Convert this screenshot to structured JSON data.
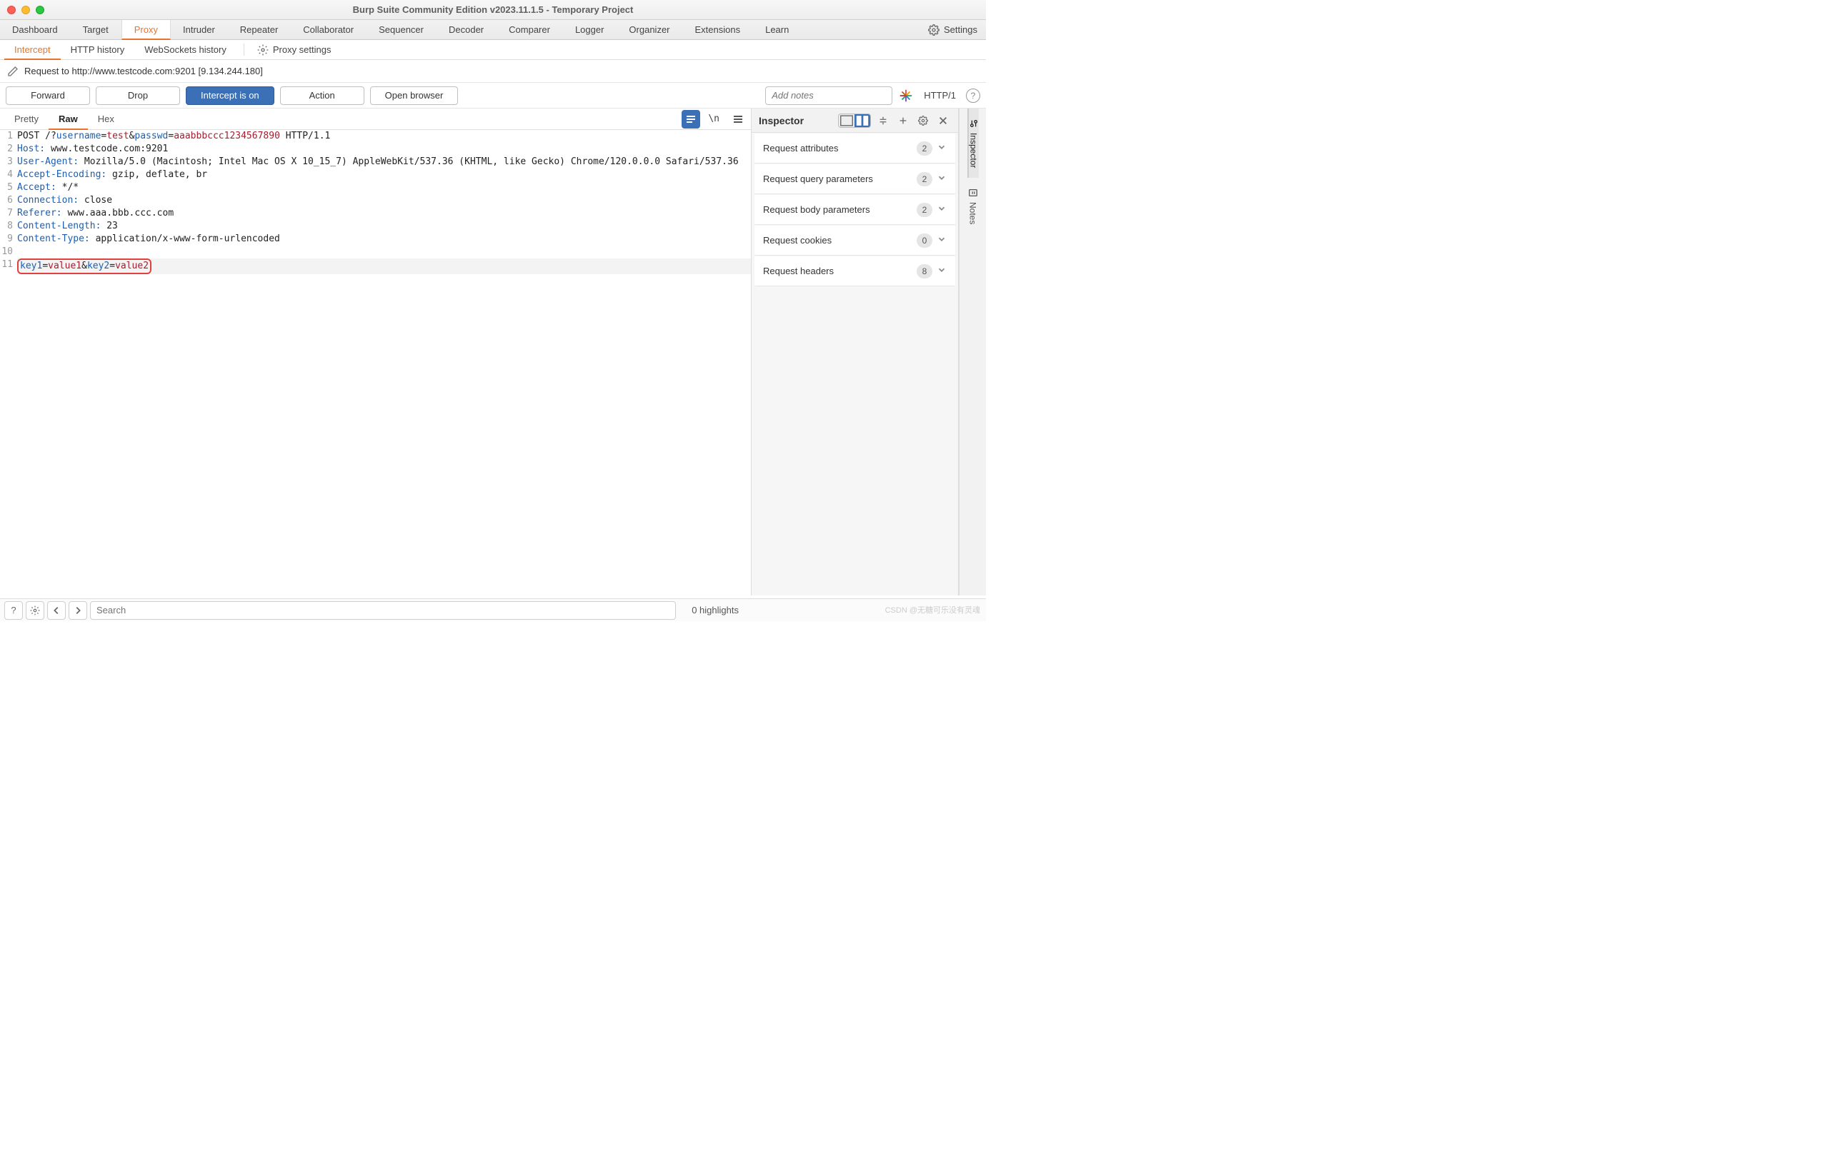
{
  "title": "Burp Suite Community Edition v2023.11.1.5 - Temporary Project",
  "mainTabs": [
    "Dashboard",
    "Target",
    "Proxy",
    "Intruder",
    "Repeater",
    "Collaborator",
    "Sequencer",
    "Decoder",
    "Comparer",
    "Logger",
    "Organizer",
    "Extensions",
    "Learn"
  ],
  "mainActive": "Proxy",
  "settingsLabel": "Settings",
  "subTabs": [
    "Intercept",
    "HTTP history",
    "WebSockets history"
  ],
  "subActive": "Intercept",
  "proxySettingsLabel": "Proxy settings",
  "requestLine": "Request to http://www.testcode.com:9201  [9.134.244.180]",
  "buttons": {
    "forward": "Forward",
    "drop": "Drop",
    "intercept": "Intercept is on",
    "action": "Action",
    "open": "Open browser"
  },
  "notesPlaceholder": "Add notes",
  "httpVersion": "HTTP/1",
  "viewTabs": [
    "Pretty",
    "Raw",
    "Hex"
  ],
  "viewActive": "Raw",
  "newlineLabel": "\\n",
  "rawLines": [
    {
      "n": 1,
      "segs": [
        {
          "t": "POST /?",
          "c": "plain"
        },
        {
          "t": "username",
          "c": "key"
        },
        {
          "t": "=",
          "c": "plain"
        },
        {
          "t": "test",
          "c": "val"
        },
        {
          "t": "&",
          "c": "plain"
        },
        {
          "t": "passwd",
          "c": "key"
        },
        {
          "t": "=",
          "c": "plain"
        },
        {
          "t": "aaabbbccc1234567890",
          "c": "val"
        },
        {
          "t": " HTTP/1.1",
          "c": "plain"
        }
      ]
    },
    {
      "n": 2,
      "segs": [
        {
          "t": "Host:",
          "c": "key"
        },
        {
          "t": " www.testcode.com:9201",
          "c": "plain"
        }
      ]
    },
    {
      "n": 3,
      "segs": [
        {
          "t": "User-Agent:",
          "c": "key"
        },
        {
          "t": " Mozilla/5.0 (Macintosh; Intel Mac OS X 10_15_7) AppleWebKit/537.36 (KHTML, like Gecko) Chrome/120.0.0.0 Safari/537.36",
          "c": "plain"
        }
      ]
    },
    {
      "n": 4,
      "segs": [
        {
          "t": "Accept-Encoding:",
          "c": "key"
        },
        {
          "t": " gzip, deflate, br",
          "c": "plain"
        }
      ]
    },
    {
      "n": 5,
      "segs": [
        {
          "t": "Accept:",
          "c": "key"
        },
        {
          "t": " */*",
          "c": "plain"
        }
      ]
    },
    {
      "n": 6,
      "segs": [
        {
          "t": "Connection:",
          "c": "key"
        },
        {
          "t": " close",
          "c": "plain"
        }
      ]
    },
    {
      "n": 7,
      "segs": [
        {
          "t": "Referer:",
          "c": "key"
        },
        {
          "t": " www.aaa.bbb.ccc.com",
          "c": "plain"
        }
      ]
    },
    {
      "n": 8,
      "segs": [
        {
          "t": "Content-Length:",
          "c": "key"
        },
        {
          "t": " 23",
          "c": "plain"
        }
      ]
    },
    {
      "n": 9,
      "segs": [
        {
          "t": "Content-Type:",
          "c": "key"
        },
        {
          "t": " application/x-www-form-urlencoded",
          "c": "plain"
        }
      ]
    },
    {
      "n": 10,
      "segs": []
    },
    {
      "n": 11,
      "hl": true,
      "body": true,
      "segs": [
        {
          "t": "key1",
          "c": "key"
        },
        {
          "t": "=",
          "c": "plain"
        },
        {
          "t": "value1",
          "c": "val"
        },
        {
          "t": "&",
          "c": "plain"
        },
        {
          "t": "key2",
          "c": "key"
        },
        {
          "t": "=",
          "c": "plain"
        },
        {
          "t": "value2",
          "c": "val"
        }
      ]
    }
  ],
  "inspector": {
    "title": "Inspector",
    "rows": [
      {
        "label": "Request attributes",
        "count": "2"
      },
      {
        "label": "Request query parameters",
        "count": "2"
      },
      {
        "label": "Request body parameters",
        "count": "2"
      },
      {
        "label": "Request cookies",
        "count": "0"
      },
      {
        "label": "Request headers",
        "count": "8"
      }
    ]
  },
  "rightRail": [
    "Inspector",
    "Notes"
  ],
  "rightRailActive": "Inspector",
  "bottomSearchPlaceholder": "Search",
  "highlightsText": "0 highlights",
  "watermark": "CSDN @无糖可乐没有灵魂"
}
